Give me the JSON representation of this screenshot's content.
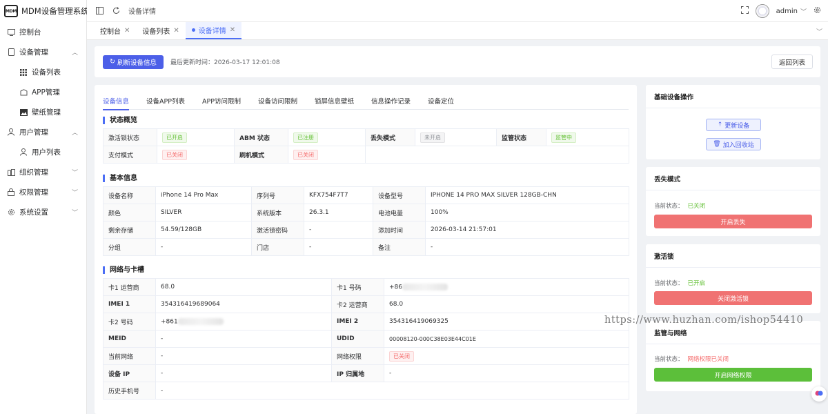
{
  "app": {
    "title": "MDM设备管理系统",
    "logo_text": "MDM"
  },
  "sidebar": {
    "items": [
      {
        "label": "控制台",
        "icon": "monitor-icon"
      },
      {
        "label": "设备管理",
        "icon": "tablet-icon"
      },
      {
        "label": "设备列表",
        "icon": "grid-icon"
      },
      {
        "label": "APP管理",
        "icon": "app-icon"
      },
      {
        "label": "壁纸管理",
        "icon": "image-icon"
      },
      {
        "label": "用户管理",
        "icon": "user-icon"
      },
      {
        "label": "用户列表",
        "icon": "user-icon"
      },
      {
        "label": "组织管理",
        "icon": "org-icon"
      },
      {
        "label": "权限管理",
        "icon": "lock-icon"
      },
      {
        "label": "系统设置",
        "icon": "gear-icon"
      }
    ]
  },
  "topbar": {
    "breadcrumb": "设备详情",
    "user": "admin"
  },
  "page_tabs": [
    {
      "label": "控制台"
    },
    {
      "label": "设备列表"
    },
    {
      "label": "设备详情"
    }
  ],
  "actions": {
    "refresh_label": "刷新设备信息",
    "last_update": "最后更新时间：2026-03-17 12:01:08",
    "back_label": "返回列表"
  },
  "detail_tabs": [
    "设备信息",
    "设备APP列表",
    "APP访问限制",
    "设备访问限制",
    "锁屏信息壁纸",
    "信息操作记录",
    "设备定位"
  ],
  "status_overview": {
    "title": "状态概览",
    "row1": [
      {
        "label": "激活锁状态",
        "value": "已开启"
      },
      {
        "label": "ABM 状态",
        "value": "已注册"
      },
      {
        "label": "丢失模式",
        "value": "未开启"
      },
      {
        "label": "监管状态",
        "value": "监管中"
      }
    ],
    "row2": [
      {
        "label": "支付模式",
        "value": "已关闭"
      },
      {
        "label": "刷机模式",
        "value": "已关闭"
      }
    ]
  },
  "basic_info": {
    "title": "基本信息",
    "rows": [
      [
        {
          "label": "设备名称",
          "value": "iPhone 14 Pro Max"
        },
        {
          "label": "序列号",
          "value": "KFX754F7T7"
        },
        {
          "label": "设备型号",
          "value": "IPHONE 14 PRO MAX SILVER 128GB-CHN"
        }
      ],
      [
        {
          "label": "颜色",
          "value": "SILVER"
        },
        {
          "label": "系统版本",
          "value": "26.3.1"
        },
        {
          "label": "电池电量",
          "value": "100%"
        }
      ],
      [
        {
          "label": "剩余存储",
          "value": "54.59/128GB"
        },
        {
          "label": "激活锁密码",
          "value": "-"
        },
        {
          "label": "添加时间",
          "value": "2026-03-14 21:57:01"
        }
      ],
      [
        {
          "label": "分组",
          "value": "-"
        },
        {
          "label": "门店",
          "value": "-"
        },
        {
          "label": "备注",
          "value": "-"
        }
      ]
    ]
  },
  "network": {
    "title": "网络与卡槽",
    "rows": [
      [
        {
          "label": "卡1 运营商",
          "value": "68.0"
        },
        {
          "label": "卡1 号码",
          "value": "+86"
        }
      ],
      [
        {
          "label": "IMEI 1",
          "value": "354316419689064"
        },
        {
          "label": "卡2 运营商",
          "value": "68.0"
        }
      ],
      [
        {
          "label": "卡2 号码",
          "value": "+861"
        },
        {
          "label": "IMEI 2",
          "value": "354316419069325"
        }
      ],
      [
        {
          "label": "MEID",
          "value": "-"
        },
        {
          "label": "UDID",
          "value": "00008120-000C38E03E44C01E"
        }
      ],
      [
        {
          "label": "当前网络",
          "value": "-"
        },
        {
          "label": "网络权限",
          "value": "已关闭"
        }
      ],
      [
        {
          "label": "设备 IP",
          "value": "-"
        },
        {
          "label": "IP 归属地",
          "value": "-"
        }
      ],
      [
        {
          "label": "历史手机号",
          "value": "-"
        }
      ]
    ]
  },
  "right": {
    "basic_ops": {
      "title": "基础设备操作",
      "update_label": "更新设备",
      "recycle_label": "加入回收站"
    },
    "lost_mode": {
      "title": "丢失模式",
      "status_label": "当前状态：",
      "status_value": "已关闭",
      "button": "开启丢失"
    },
    "activation_lock": {
      "title": "激活锁",
      "status_label": "当前状态：",
      "status_value": "已开启",
      "button": "关闭激活锁"
    },
    "network_ctrl": {
      "title": "监管与网络",
      "status_label": "当前状态：",
      "status_value": "网络权限已关闭",
      "button": "开启网络权限"
    }
  },
  "watermark": "https://www.huzhan.com/ishop54410",
  "colors": {
    "primary": "#4c5fe8",
    "success": "#67c23a",
    "danger": "#f56c6c"
  }
}
